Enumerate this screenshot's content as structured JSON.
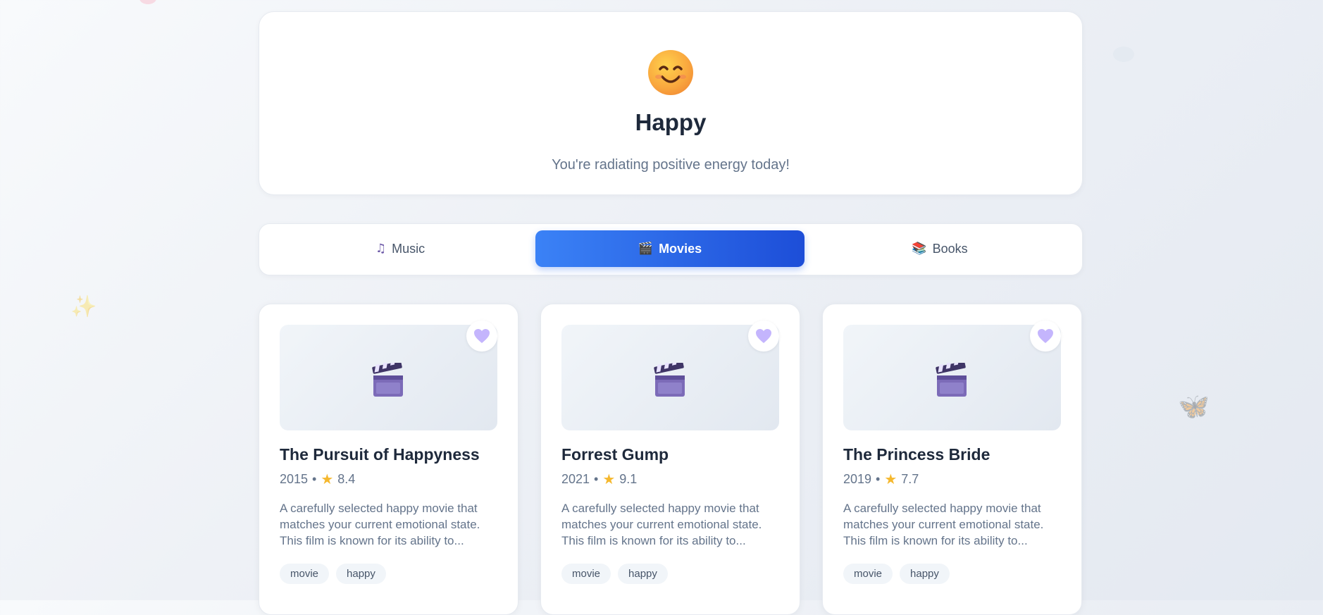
{
  "decorations": {
    "sparkle": "✨",
    "butterfly": "🦋"
  },
  "mood": {
    "icon": "smiling-face-icon",
    "title": "Happy",
    "subtitle": "You're radiating positive energy today!"
  },
  "tabs": [
    {
      "label": "Music",
      "icon": "♫",
      "active": false
    },
    {
      "label": "Movies",
      "icon": "🎬",
      "active": true
    },
    {
      "label": "Books",
      "icon": "📚",
      "active": false
    }
  ],
  "movies": [
    {
      "title": "The Pursuit of Happyness",
      "year": "2015",
      "rating": "8.4",
      "description": "A carefully selected happy movie that matches your current emotional state. This film is known for its ability to...",
      "tags": [
        "movie",
        "happy"
      ]
    },
    {
      "title": "Forrest Gump",
      "year": "2021",
      "rating": "9.1",
      "description": "A carefully selected happy movie that matches your current emotional state. This film is known for its ability to...",
      "tags": [
        "movie",
        "happy"
      ]
    },
    {
      "title": "The Princess Bride",
      "year": "2019",
      "rating": "7.7",
      "description": "A carefully selected happy movie that matches your current emotional state. This film is known for its ability to...",
      "tags": [
        "movie",
        "happy"
      ]
    }
  ],
  "meta": {
    "separator": "•",
    "star": "★"
  },
  "colors": {
    "accent": "#2563eb",
    "heart": "#c4b5fd"
  }
}
